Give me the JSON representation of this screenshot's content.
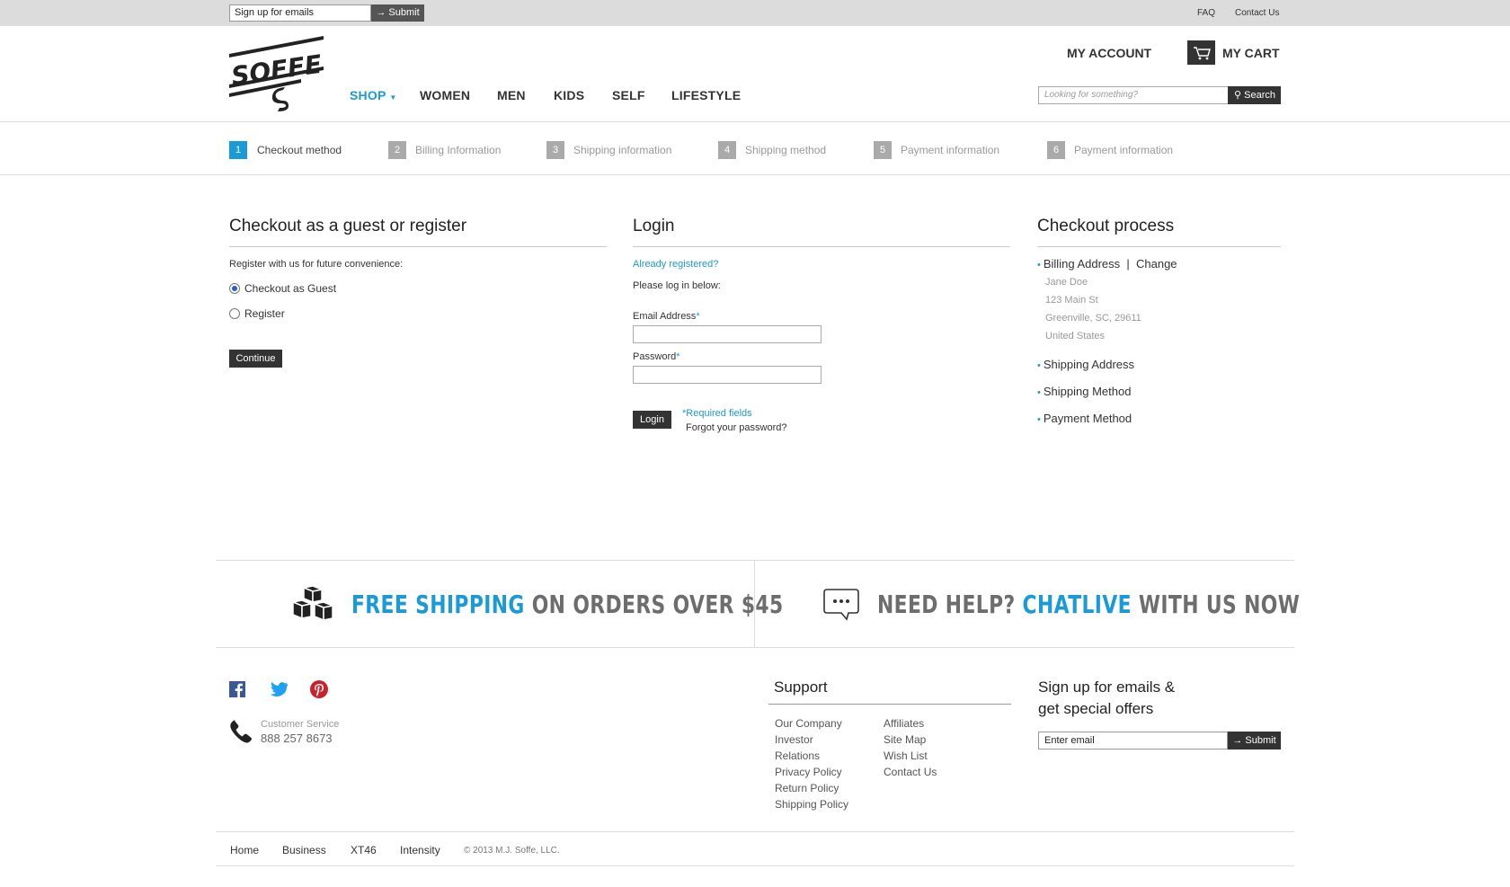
{
  "topbar": {
    "email_value": "Sign up for emails",
    "submit_label": "→ Submit",
    "faq": "FAQ",
    "contact": "Contact Us"
  },
  "header": {
    "logo_text": "SOFFE",
    "nav": [
      "SHOP",
      "WOMEN",
      "MEN",
      "KIDS",
      "SELF",
      "LIFESTYLE"
    ],
    "my_account": "MY ACCOUNT",
    "my_cart": "MY CART",
    "search_placeholder": "Looking for something?",
    "search_label": "Search"
  },
  "steps": [
    {
      "num": "1",
      "label": "Checkout method"
    },
    {
      "num": "2",
      "label": "Billing Information"
    },
    {
      "num": "3",
      "label": "Shipping information"
    },
    {
      "num": "4",
      "label": "Shipping method"
    },
    {
      "num": "5",
      "label": "Payment information"
    },
    {
      "num": "6",
      "label": "Payment information"
    }
  ],
  "guest": {
    "title": "Checkout as a guest or register",
    "intro": "Register with us for future convenience:",
    "option_guest": "Checkout as Guest",
    "option_register": "Register",
    "continue": "Continue"
  },
  "login": {
    "title": "Login",
    "already": "Already registered?",
    "please": "Please log in below:",
    "email_label": "Email Address",
    "password_label": "Password",
    "required_mark": "*",
    "login_btn": "Login",
    "required_fields": "*Required fields",
    "forgot": "Forgot your password?"
  },
  "process": {
    "title": "Checkout process",
    "billing": "Billing Address",
    "separator": "|",
    "change": "Change",
    "address": [
      "Jane Doe",
      "123 Main St",
      "Greenville, SC, 29611",
      "United States"
    ],
    "shipping_address": "Shipping Address",
    "shipping_method": "Shipping Method",
    "payment_method": "Payment Method"
  },
  "promo": {
    "shipping_blue": "FREE SHIPPING",
    "shipping_gray": " ON ORDERS OVER $45",
    "help_gray": "NEED HELP? ",
    "help_blue": "CHATLIVE",
    "help_gray2": " WITH US NOW"
  },
  "footer": {
    "cs_label": "Customer Service",
    "cs_phone": "888 257 8673",
    "support_title": "Support",
    "support_col1": [
      "Our Company",
      "Investor",
      "Relations",
      "Privacy Policy",
      "Return Policy",
      "Shipping Policy"
    ],
    "support_col2": [
      "Affiliates",
      "Site Map",
      "Wish List",
      "Contact Us"
    ],
    "signup_title_1": "Sign up for emails &",
    "signup_title_2": "get special offers",
    "signup_value": "Enter email",
    "signup_submit": "→ Submit",
    "bottom_links": [
      "Home",
      "Business",
      "XT46",
      "Intensity"
    ],
    "copyright": "© 2013 M.J. Soffe, LLC."
  },
  "colors": {
    "accent": "#1a9ad6",
    "dark": "#333333",
    "pinterest": "#c8232c",
    "facebook": "#3b5998",
    "twitter": "#1da1f2"
  }
}
